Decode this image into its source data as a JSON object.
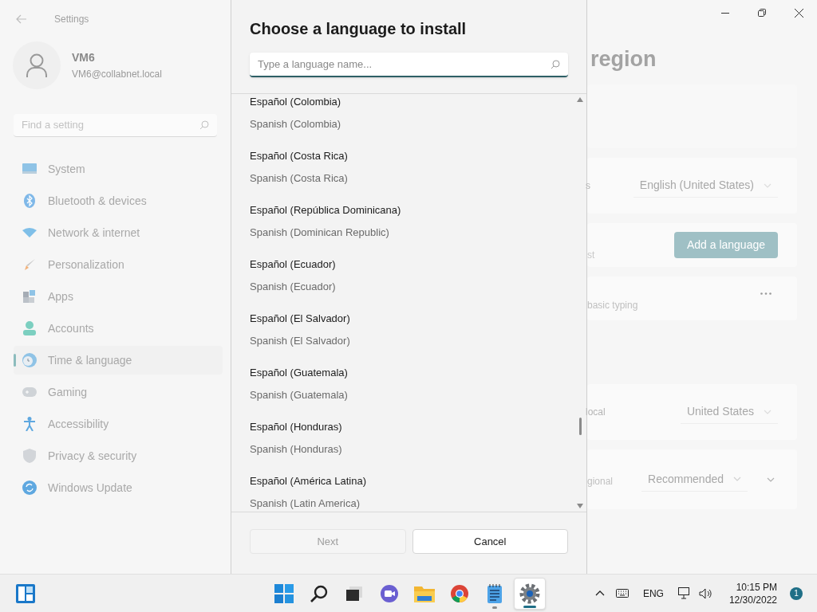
{
  "settings": {
    "title": "Settings",
    "user": {
      "name": "VM6",
      "email": "VM6@collabnet.local"
    },
    "search": {
      "placeholder": "Find a setting"
    },
    "nav": [
      {
        "label": "System",
        "selected": false
      },
      {
        "label": "Bluetooth & devices",
        "selected": false
      },
      {
        "label": "Network & internet",
        "selected": false
      },
      {
        "label": "Personalization",
        "selected": false
      },
      {
        "label": "Apps",
        "selected": false
      },
      {
        "label": "Accounts",
        "selected": false
      },
      {
        "label": "Time & language",
        "selected": true
      },
      {
        "label": "Gaming",
        "selected": false
      },
      {
        "label": "Accessibility",
        "selected": false
      },
      {
        "label": "Privacy & security",
        "selected": false
      },
      {
        "label": "Windows Update",
        "selected": false
      }
    ],
    "page_title": "region",
    "sections": [
      [
        {
          "kind": "blank"
        },
        {
          "kind": "dropdown",
          "label": "s",
          "value": "English (United States)"
        },
        {
          "kind": "button",
          "label": "st",
          "button": "Add a language"
        },
        {
          "kind": "more",
          "label": "basic typing"
        }
      ],
      [
        {
          "kind": "dropdown",
          "label": "local",
          "value": "United States"
        },
        {
          "kind": "dropdown_expand",
          "label": "gional",
          "value": "Recommended"
        }
      ]
    ]
  },
  "dialog": {
    "title": "Choose a language to install",
    "search": {
      "placeholder": "Type a language name..."
    },
    "languages": [
      {
        "native": "Español (Colombia)",
        "english": "Spanish (Colombia)"
      },
      {
        "native": "Español (Costa Rica)",
        "english": "Spanish (Costa Rica)"
      },
      {
        "native": "Español (República Dominicana)",
        "english": "Spanish (Dominican Republic)"
      },
      {
        "native": "Español (Ecuador)",
        "english": "Spanish (Ecuador)"
      },
      {
        "native": "Español (El Salvador)",
        "english": "Spanish (El Salvador)"
      },
      {
        "native": "Español (Guatemala)",
        "english": "Spanish (Guatemala)"
      },
      {
        "native": "Español (Honduras)",
        "english": "Spanish (Honduras)"
      },
      {
        "native": "Español (América Latina)",
        "english": "Spanish (Latin America)"
      }
    ],
    "buttons": [
      {
        "label": "Next",
        "disabled": true
      },
      {
        "label": "Cancel",
        "disabled": false
      }
    ]
  },
  "taskbar": {
    "apps": [
      {
        "selected": false,
        "running": false
      },
      {
        "selected": false,
        "running": false
      },
      {
        "selected": false,
        "running": false
      },
      {
        "selected": false,
        "running": false
      },
      {
        "selected": false,
        "running": false
      },
      {
        "selected": false,
        "running": false
      },
      {
        "selected": false,
        "running": true
      },
      {
        "selected": true,
        "running": true
      }
    ],
    "language": "ENG",
    "time": "10:15 PM",
    "date": "12/30/2022",
    "notifications": "1"
  }
}
